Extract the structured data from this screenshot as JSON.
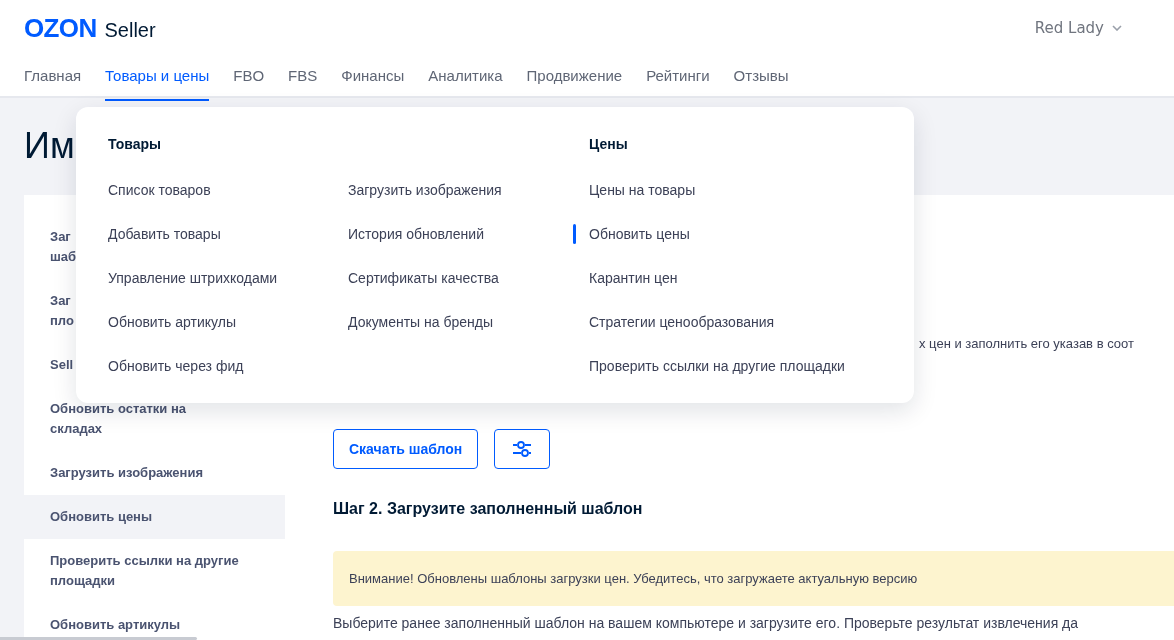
{
  "brand": {
    "logo": "OZON",
    "product": "Seller"
  },
  "user": {
    "name": "Red Lady"
  },
  "nav": [
    {
      "label": "Главная",
      "selected": false
    },
    {
      "label": "Товары и цены",
      "selected": true
    },
    {
      "label": "FBO",
      "selected": false
    },
    {
      "label": "FBS",
      "selected": false
    },
    {
      "label": "Финансы",
      "selected": false
    },
    {
      "label": "Аналитика",
      "selected": false
    },
    {
      "label": "Продвижение",
      "selected": false
    },
    {
      "label": "Рейтинги",
      "selected": false
    },
    {
      "label": "Отзывы",
      "selected": false
    }
  ],
  "page_title": "Им",
  "sidebar": {
    "items": [
      {
        "lines": [
          "Заг",
          "шаб"
        ],
        "selected": false
      },
      {
        "lines": [
          "Заг",
          "пло"
        ],
        "selected": false
      },
      {
        "lines": [
          "Sell"
        ],
        "selected": false
      },
      {
        "lines": [
          "Обновить остатки на",
          "складах"
        ],
        "selected": false
      },
      {
        "lines": [
          "Загрузить изображения"
        ],
        "selected": false
      },
      {
        "lines": [
          "Обновить цены"
        ],
        "selected": true
      },
      {
        "lines": [
          "Проверить ссылки на другие",
          "площадки"
        ],
        "selected": false
      },
      {
        "lines": [
          "Обновить артикулы"
        ],
        "selected": false
      }
    ]
  },
  "content": {
    "intro_fragment": "х цен и заполнить его указав в соот",
    "download_button": "Скачать шаблон",
    "step2_title": "Шаг 2. Загрузите заполненный шаблон",
    "notice": "Внимание! Обновлены шаблоны загрузки цен. Убедитесь, что загружаете актуальную версию",
    "instructions": "Выберите ранее заполненный шаблон на вашем компьютере и загрузите его. Проверьте результат извлечения да"
  },
  "dropdown": {
    "columns": [
      {
        "heading": "Товары",
        "items": [
          {
            "label": "Список товаров",
            "selected": false
          },
          {
            "label": "Добавить товары",
            "selected": false
          },
          {
            "label": "Управление штрихкодами",
            "selected": false
          },
          {
            "label": "Обновить артикулы",
            "selected": false
          },
          {
            "label": "Обновить через фид",
            "selected": false
          }
        ]
      },
      {
        "items": [
          {
            "label": "Загрузить изображения",
            "selected": false
          },
          {
            "label": "История обновлений",
            "selected": false
          },
          {
            "label": "Сертификаты качества",
            "selected": false
          },
          {
            "label": "Документы на бренды",
            "selected": false
          }
        ]
      },
      {
        "heading": "Цены",
        "items": [
          {
            "label": "Цены на товары",
            "selected": false
          },
          {
            "label": "Обновить цены",
            "selected": true
          },
          {
            "label": "Карантин цен",
            "selected": false
          },
          {
            "label": "Стратегии ценообразования",
            "selected": false
          },
          {
            "label": "Проверить ссылки на другие площадки",
            "selected": false
          }
        ]
      }
    ]
  }
}
